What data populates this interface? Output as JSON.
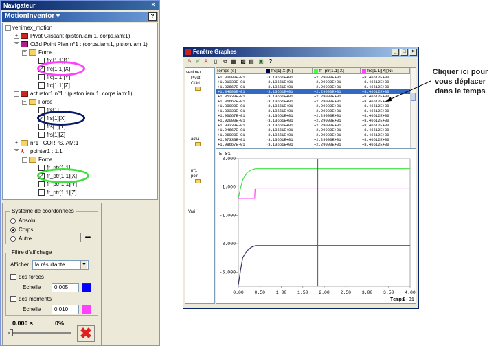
{
  "navigator": {
    "title": "Navigateur",
    "close": "×",
    "panel_title": "MotionInventor",
    "help": "?",
    "tree": [
      {
        "text": "venimex_motion"
      },
      {
        "text": "Pivot Glissant (piston.iam:1, corps.iam:1)"
      },
      {
        "text": "Ct3d Point Plan n°1 : (corps.iam:1, piston.iam:1)"
      },
      {
        "text": "Force"
      },
      {
        "text": "frc[1.1][1]"
      },
      {
        "text": "frc[1.1][X]"
      },
      {
        "text": "frc[1.1][Y]"
      },
      {
        "text": "frc[1.1][Z]"
      },
      {
        "text": "actuator1 n°1 : (piston.iam:1, corps.iam:1)"
      },
      {
        "text": "Force"
      },
      {
        "text": "frs[1]"
      },
      {
        "text": "frs[1][X]"
      },
      {
        "text": "frs[1][Y]"
      },
      {
        "text": "frs[1][Z]"
      },
      {
        "text": "n°1 : CORPS.IAM:1"
      },
      {
        "text": "pointer1 : 1.1"
      },
      {
        "text": "Force"
      },
      {
        "text": "fr_ptr[1.1]"
      },
      {
        "text": "fr_ptr[1.1][X]"
      },
      {
        "text": "fr_ptr[1.1][Y]"
      },
      {
        "text": "fr_ptr[1.1][Z]"
      }
    ],
    "coord_system": {
      "title": "Système de coordonnées",
      "options": [
        "Absolu",
        "Corps",
        "Autre"
      ],
      "selected": "Corps",
      "more_button": "•••"
    },
    "display_filter": {
      "title": "Filtre d'affichage",
      "show_label": "Afficher",
      "show_value": "la résultante",
      "forces_label": "des forces",
      "forces_scale_label": "Echelle :",
      "forces_scale": "0.005",
      "forces_color": "#0000ff",
      "moments_label": "des moments",
      "moments_scale_label": "Echelle :",
      "moments_scale": "0.010",
      "moments_color": "#ff40ff"
    },
    "time": "0.000 s",
    "percent": "0%"
  },
  "graph_window": {
    "title": "Fenêtre Graphes",
    "minimize": "_",
    "maximize": "□",
    "close": "×",
    "tree": [
      "venimex",
      "Pivot",
      "Ct3d",
      "actu",
      "n°1",
      "poir",
      "Vari"
    ],
    "columns": [
      {
        "label": "Temps (s)",
        "color": ""
      },
      {
        "label": "frs[1][X](N)",
        "color": "#000040"
      },
      {
        "label": "fr_ptr[1.1][X]",
        "color": "#40ff40"
      },
      {
        "label": "frc[1.1][X](N)",
        "color": "#ff40ff"
      }
    ],
    "rows": [
      [
        "+1.80000E-01",
        "-3.13661E+01",
        "+2.29000E+01",
        "+8.46612E+00"
      ],
      [
        "+1.81333E-01",
        "-3.13661E+01",
        "+2.29000E+01",
        "+8.46612E+00"
      ],
      [
        "+1.82667E-01",
        "-3.13661E+01",
        "+2.29000E+01",
        "+8.46612E+00"
      ],
      [
        "+1.84000E-01",
        "-3.13661E+01",
        "+2.29000E+01",
        "+8.46612E+00"
      ],
      [
        "+1.85333E-01",
        "-3.13661E+01",
        "+2.29000E+01",
        "+8.46612E+00"
      ],
      [
        "+1.86667E-01",
        "-3.13661E+01",
        "+2.29000E+01",
        "+8.46612E+00"
      ],
      [
        "+1.88000E-01",
        "-3.13661E+01",
        "+2.29000E+01",
        "+8.46612E+00"
      ],
      [
        "+1.89333E-01",
        "-3.13661E+01",
        "+2.29000E+01",
        "+8.46612E+00"
      ],
      [
        "+1.90667E-01",
        "-3.13661E+01",
        "+2.29000E+01",
        "+8.46612E+00"
      ],
      [
        "+1.92000E-01",
        "-3.13661E+01",
        "+2.29000E+01",
        "+8.46612E+00"
      ],
      [
        "+1.93333E-01",
        "-3.13661E+01",
        "+2.29000E+01",
        "+8.46612E+00"
      ],
      [
        "+1.94667E-01",
        "-3.13661E+01",
        "+2.29000E+01",
        "+8.46612E+00"
      ],
      [
        "+1.96000E-01",
        "-3.13661E+01",
        "+2.29000E+01",
        "+8.46612E+00"
      ],
      [
        "+1.97333E-01",
        "-3.13661E+01",
        "+2.29000E+01",
        "+8.46612E+00"
      ],
      [
        "+1.98667E-01",
        "-3.13661E+01",
        "+2.29000E+01",
        "+8.46612E+00"
      ]
    ],
    "selected_row": 3,
    "plot_y_label": "E 01",
    "plot_x_label": "Temps",
    "plot_x_exp": "E-01"
  },
  "annotation": "Cliquer ici pour vous déplacer dans le temps",
  "chart_data": {
    "type": "line",
    "xlabel": "Temps E-01",
    "ylabel": "E 01",
    "xlim": [
      0.0,
      4.0
    ],
    "ylim": [
      -6.0,
      3.0
    ],
    "xticks": [
      "0.00",
      "0.50",
      "1.00",
      "1.50",
      "2.00",
      "2.50",
      "3.00",
      "3.50",
      "4.00"
    ],
    "yticks": [
      "3.000",
      "1.000",
      "-1.000",
      "-3.000",
      "-5.000"
    ],
    "cursor_x": 1.85,
    "series": [
      {
        "color": "#40e040",
        "x": [
          0,
          0.05,
          0.1,
          0.2,
          0.3,
          0.4,
          4.0
        ],
        "y": [
          0.2,
          0.9,
          1.5,
          2.0,
          2.2,
          2.29,
          2.29
        ]
      },
      {
        "color": "#ff40ff",
        "x": [
          0,
          0.38,
          0.39,
          0.4,
          4.0
        ],
        "y": [
          0.2,
          0.2,
          0.85,
          0.85,
          0.85
        ]
      },
      {
        "color": "#403060",
        "x": [
          0,
          0.05,
          0.1,
          0.2,
          0.3,
          0.4,
          4.0
        ],
        "y": [
          -5.9,
          -4.9,
          -4.0,
          -3.5,
          -3.25,
          -3.14,
          -3.14
        ]
      }
    ]
  }
}
